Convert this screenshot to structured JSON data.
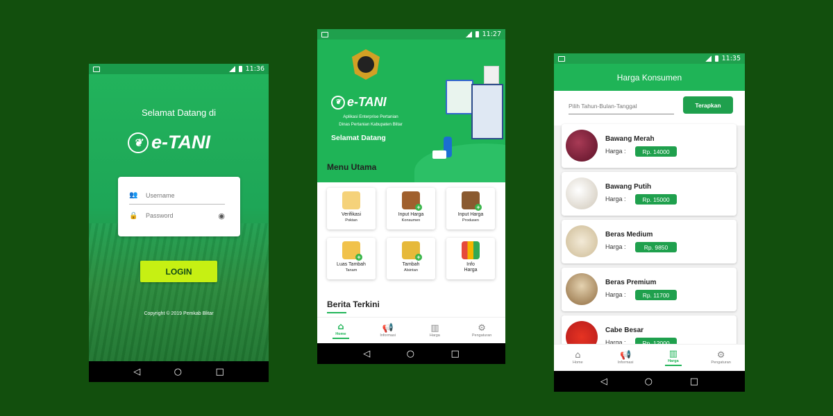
{
  "colors": {
    "background": "#124f0d",
    "primary_green": "#1fb457",
    "login_button": "#c6f013"
  },
  "phones": [
    {
      "status": {
        "time": "11:36"
      },
      "nav": {
        "back": "◁",
        "home": "○",
        "recent": "□"
      }
    },
    {
      "status": {
        "time": "11:27"
      },
      "nav": {
        "back": "◁",
        "home": "○",
        "recent": "□"
      }
    },
    {
      "status": {
        "time": "11:35"
      },
      "nav": {
        "back": "◁",
        "home": "○",
        "recent": "□"
      }
    }
  ],
  "login": {
    "welcome": "Selamat Datang di",
    "logo_text": "e-TANI",
    "username_placeholder": "Username",
    "password_placeholder": "Password",
    "login_button": "LOGIN",
    "copyright": "Copyright © 2019 Pemkab Blitar"
  },
  "home": {
    "logo_text": "e-TANI",
    "subtitle_1": "Aplikasi Enterprise Pertanian",
    "subtitle_2": "Dinas Pertanian Kabupaten Blitar",
    "welcome": "Selamat Datang",
    "menu_title": "Menu Utama",
    "tiles": [
      {
        "label": "Verifikasi",
        "sub": "Poktan",
        "icon": "farmer-icon"
      },
      {
        "label": "Input Harga",
        "sub": "Konsumen",
        "icon": "vegetable-basket-icon"
      },
      {
        "label": "Input Harga",
        "sub": "Produsen",
        "icon": "seed-sack-icon"
      },
      {
        "label": "Luas Tambah",
        "sub": "Tanam",
        "icon": "wheat-icon"
      },
      {
        "label": "Tambah",
        "sub": "Alsintan",
        "icon": "tractor-icon"
      },
      {
        "label": "Info",
        "sub": "Harga",
        "icon": "chart-icon"
      }
    ],
    "news_title": "Berita Terkini"
  },
  "bottom_nav": [
    {
      "label": "Home",
      "icon": "home-icon"
    },
    {
      "label": "Informasi",
      "icon": "megaphone-icon"
    },
    {
      "label": "Harga",
      "icon": "bar-chart-icon"
    },
    {
      "label": "Pengaturan",
      "icon": "gear-icon"
    }
  ],
  "prices": {
    "title": "Harga Konsumen",
    "date_placeholder": "Pilih Tahun-Bulan-Tanggal",
    "apply_button": "Terapkan",
    "harga_label": "Harga  :",
    "items": [
      {
        "name": "Bawang Merah",
        "price": "Rp. 14000"
      },
      {
        "name": "Bawang Putih",
        "price": "Rp. 15000"
      },
      {
        "name": "Beras Medium",
        "price": "Rp. 9850"
      },
      {
        "name": "Beras Premium",
        "price": "Rp. 11700"
      },
      {
        "name": "Cabe Besar",
        "price": "Rp. 12000"
      }
    ]
  }
}
